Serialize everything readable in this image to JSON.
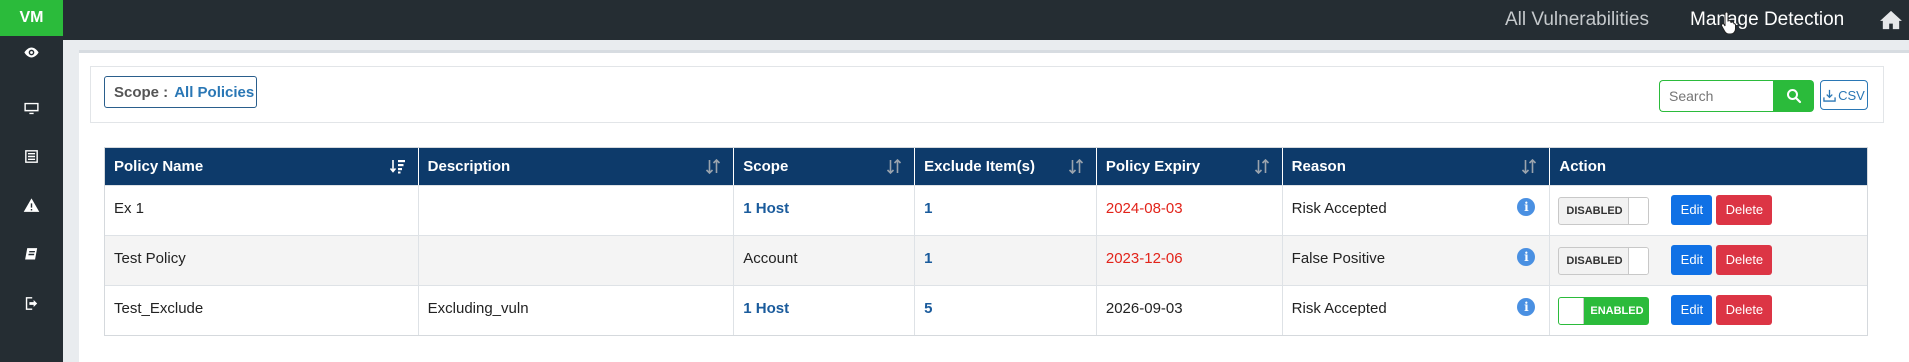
{
  "app": {
    "logo": "VM"
  },
  "sidebar": {
    "items": [
      {
        "icon": "eye-icon"
      },
      {
        "icon": "monitor-icon"
      },
      {
        "icon": "list-icon"
      },
      {
        "icon": "warning-icon"
      },
      {
        "icon": "book-icon"
      },
      {
        "icon": "logout-icon"
      }
    ]
  },
  "topnav": {
    "all_vulnerabilities": "All Vulnerabilities",
    "manage_detection": "Manage Detection",
    "home_icon": "home-icon"
  },
  "toolbar": {
    "scope_label": "Scope :",
    "scope_value": "All Policies",
    "search_placeholder": "Search",
    "csv_label": "CSV"
  },
  "table": {
    "headers": [
      "Policy Name",
      "Description",
      "Scope",
      "Exclude Item(s)",
      "Policy Expiry",
      "Reason",
      "Action"
    ],
    "rows": [
      {
        "policy_name": "Ex 1",
        "description": "",
        "scope": "1 Host",
        "scope_link": true,
        "exclude_items": "1",
        "expiry": "2024-08-03",
        "expired": true,
        "reason": "Risk Accepted",
        "status": "DISABLED",
        "enabled": false,
        "edit": "Edit",
        "delete": "Delete"
      },
      {
        "policy_name": "Test Policy",
        "description": "",
        "scope": "Account",
        "scope_link": false,
        "exclude_items": "1",
        "expiry": "2023-12-06",
        "expired": true,
        "reason": "False Positive",
        "status": "DISABLED",
        "enabled": false,
        "edit": "Edit",
        "delete": "Delete"
      },
      {
        "policy_name": "Test_Exclude",
        "description": "Excluding_vuln",
        "scope": "1 Host",
        "scope_link": true,
        "exclude_items": "5",
        "expiry": "2026-09-03",
        "expired": false,
        "reason": "Risk Accepted",
        "status": "ENABLED",
        "enabled": true,
        "edit": "Edit",
        "delete": "Delete"
      }
    ]
  },
  "colors": {
    "brand_green": "#2bbb3b",
    "header_navy": "#0d3a6a",
    "link_blue": "#1a5b9c",
    "expired_red": "#e2231a",
    "edit_blue": "#1071e5",
    "delete_red": "#dc3545"
  }
}
